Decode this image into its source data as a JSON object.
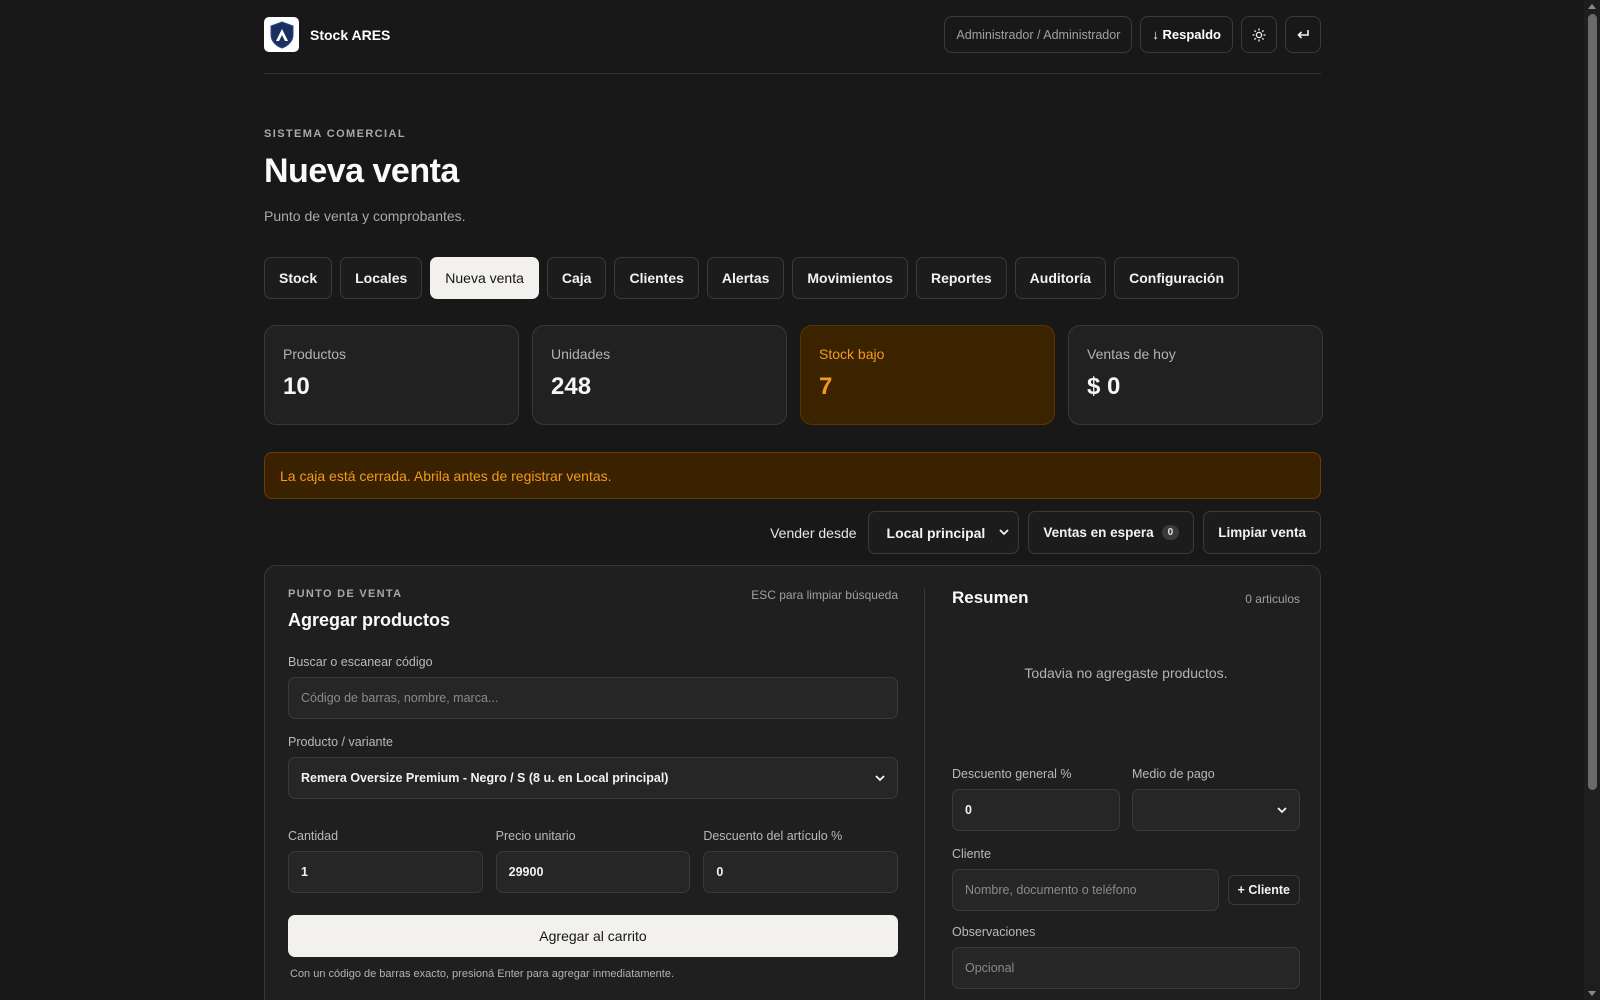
{
  "header": {
    "brand": "Stock ARES",
    "user": "Administrador / Administrador",
    "backup_label": "↓ Respaldo",
    "theme_icon": "sun-icon",
    "logout_icon": "return-icon"
  },
  "page": {
    "eyebrow": "SISTEMA COMERCIAL",
    "title": "Nueva venta",
    "subtitle": "Punto de venta y comprobantes."
  },
  "tabs": [
    {
      "label": "Stock",
      "active": false
    },
    {
      "label": "Locales",
      "active": false
    },
    {
      "label": "Nueva venta",
      "active": true
    },
    {
      "label": "Caja",
      "active": false
    },
    {
      "label": "Clientes",
      "active": false
    },
    {
      "label": "Alertas",
      "active": false
    },
    {
      "label": "Movimientos",
      "active": false
    },
    {
      "label": "Reportes",
      "active": false
    },
    {
      "label": "Auditoría",
      "active": false
    },
    {
      "label": "Configuración",
      "active": false
    }
  ],
  "stats": [
    {
      "label": "Productos",
      "value": "10"
    },
    {
      "label": "Unidades",
      "value": "248"
    },
    {
      "label": "Stock bajo",
      "value": "7"
    },
    {
      "label": "Ventas de hoy",
      "value": "$ 0"
    }
  ],
  "alert": "La caja está cerrada. Abrila antes de registrar ventas.",
  "sell_from": {
    "label": "Vender desde",
    "selected": "Local principal",
    "waiting_label": "Ventas en espera",
    "waiting_count": "0",
    "clear_label": "Limpiar venta"
  },
  "pos": {
    "eyebrow": "PUNTO DE VENTA",
    "hint": "ESC para limpiar búsqueda",
    "title": "Agregar productos",
    "search_label": "Buscar o escanear código",
    "search_placeholder": "Código de barras, nombre, marca...",
    "product_label": "Producto / variante",
    "product_selected": "Remera Oversize Premium - Negro / S (8 u. en Local principal)",
    "qty_label": "Cantidad",
    "qty_value": "1",
    "price_label": "Precio unitario",
    "price_value": "29900",
    "disc_label": "Descuento del artículo %",
    "disc_value": "0",
    "add_label": "Agregar al carrito",
    "note": "Con un código de barras exacto, presioná Enter para agregar inmediatamente."
  },
  "summary": {
    "title": "Resumen",
    "count": "0 articulos",
    "empty": "Todavia no agregaste productos.",
    "discount_label": "Descuento general %",
    "discount_value": "0",
    "payment_label": "Medio de pago",
    "payment_selected": "",
    "client_label": "Cliente",
    "client_placeholder": "Nombre, documento o teléfono",
    "add_client_label": "+ Cliente",
    "notes_label": "Observaciones",
    "notes_placeholder": "Opcional"
  }
}
